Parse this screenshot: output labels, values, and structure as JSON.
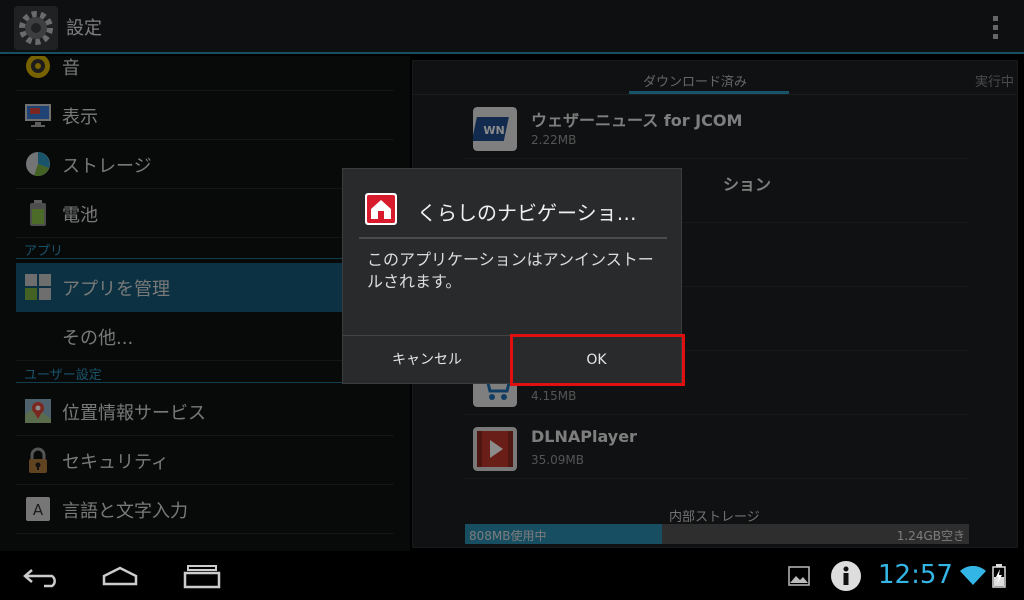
{
  "action_bar": {
    "title": "設定",
    "icon": "gear-icon"
  },
  "sidebar": {
    "items": [
      {
        "label": "音",
        "icon": "speaker-icon"
      },
      {
        "label": "表示",
        "icon": "monitor-icon"
      },
      {
        "label": "ストレージ",
        "icon": "pie-chart-icon"
      },
      {
        "label": "電池",
        "icon": "battery-icon"
      },
      {
        "label": "アプリを管理",
        "icon": "apps-grid-icon"
      },
      {
        "label": "その他...",
        "icon": ""
      },
      {
        "label": "位置情報サービス",
        "icon": "map-pin-icon"
      },
      {
        "label": "セキュリティ",
        "icon": "lock-icon"
      },
      {
        "label": "言語と文字入力",
        "icon": "keyboard-a-icon"
      }
    ],
    "sections": {
      "apps": "アプリ",
      "user": "ユーザー設定"
    }
  },
  "main": {
    "tabs": {
      "downloaded": "ダウンロード済み",
      "running": "実行中"
    },
    "apps": [
      {
        "name": "ウェザーニュース for JCOM",
        "size": "2.22MB"
      },
      {
        "name": "ション",
        "size": ""
      },
      {
        "name": "",
        "size": "4.15MB"
      },
      {
        "name": "DLNAPlayer",
        "size": "35.09MB"
      }
    ],
    "storage": {
      "label": "内部ストレージ",
      "used": "808MB使用中",
      "free": "1.24GB空き",
      "used_fraction": 0.39
    }
  },
  "dialog": {
    "title": "くらしのナビゲーショ…",
    "message": "このアプリケーションはアンインストールされます。",
    "cancel_label": "キャンセル",
    "ok_label": "OK"
  },
  "status_bar": {
    "time": "12:57"
  },
  "colors": {
    "accent": "#33b5e5",
    "selected": "#155a78",
    "highlight": "#e01010"
  }
}
